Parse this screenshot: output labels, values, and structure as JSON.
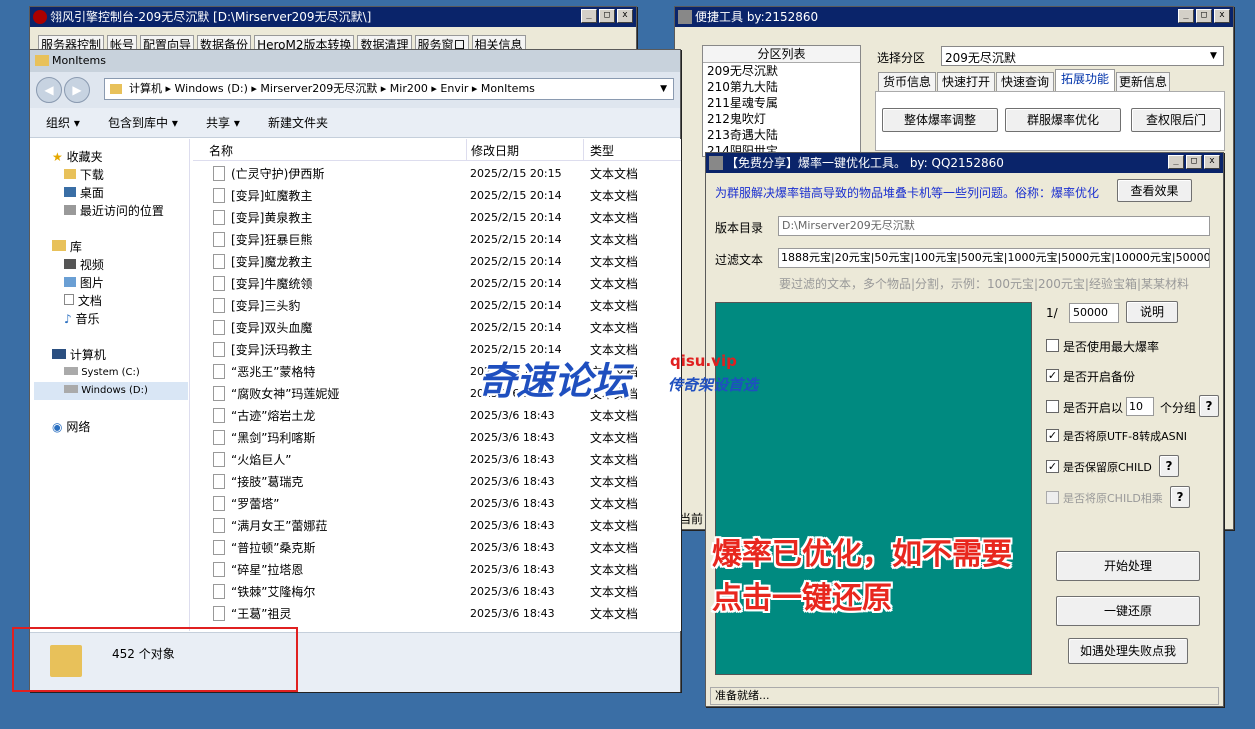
{
  "control": {
    "title": "翎风引擎控制台-209无尽沉默  [D:\\Mirserver209无尽沉默\\]",
    "menus": [
      "服务器控制",
      "帐号",
      "配置向导",
      "数据备份",
      "HeroM2版本转换",
      "数据清理",
      "服务窗口",
      "相关信息"
    ]
  },
  "explorer": {
    "title": "MonItems",
    "address": [
      "计算机",
      "Windows (D:)",
      "Mirserver209无尽沉默",
      "Mir200",
      "Envir",
      "MonItems"
    ],
    "toolbar": [
      "组织",
      "包含到库中",
      "共享",
      "新建文件夹"
    ],
    "nav": {
      "favorites": "收藏夹",
      "favorites_items": [
        "下载",
        "桌面",
        "最近访问的位置"
      ],
      "library": "库",
      "library_items": [
        "视频",
        "图片",
        "文档",
        "音乐"
      ],
      "computer": "计算机",
      "drives": [
        "System (C:)",
        "Windows (D:)"
      ],
      "network": "网络"
    },
    "columns": {
      "name": "名称",
      "date": "修改日期",
      "type": "类型"
    },
    "files": [
      {
        "name": "(亡灵守护)伊西斯",
        "date": "2025/2/15 20:15",
        "type": "文本文档"
      },
      {
        "name": "[变异]虹魔教主",
        "date": "2025/2/15 20:14",
        "type": "文本文档"
      },
      {
        "name": "[变异]黄泉教主",
        "date": "2025/2/15 20:14",
        "type": "文本文档"
      },
      {
        "name": "[变异]狂暴巨熊",
        "date": "2025/2/15 20:14",
        "type": "文本文档"
      },
      {
        "name": "[变异]魔龙教主",
        "date": "2025/2/15 20:14",
        "type": "文本文档"
      },
      {
        "name": "[变异]牛魔统领",
        "date": "2025/2/15 20:14",
        "type": "文本文档"
      },
      {
        "name": "[变异]三头豹",
        "date": "2025/2/15 20:14",
        "type": "文本文档"
      },
      {
        "name": "[变异]双头血魔",
        "date": "2025/2/15 20:14",
        "type": "文本文档"
      },
      {
        "name": "[变异]沃玛教主",
        "date": "2025/2/15 20:14",
        "type": "文本文档"
      },
      {
        "name": "“恶兆王”蒙格特",
        "date": "2025/3/6 18:43",
        "type": "文本文档"
      },
      {
        "name": "“腐败女神”玛莲妮娅",
        "date": "2025/3/6 18:43",
        "type": "文本文档"
      },
      {
        "name": "“古迹”熔岩土龙",
        "date": "2025/3/6 18:43",
        "type": "文本文档"
      },
      {
        "name": "“黑剑”玛利喀斯",
        "date": "2025/3/6 18:43",
        "type": "文本文档"
      },
      {
        "name": "“火焰巨人”",
        "date": "2025/3/6 18:43",
        "type": "文本文档"
      },
      {
        "name": "“接肢”葛瑞克",
        "date": "2025/3/6 18:43",
        "type": "文本文档"
      },
      {
        "name": "“罗蕾塔”",
        "date": "2025/3/6 18:43",
        "type": "文本文档"
      },
      {
        "name": "“满月女王”蕾娜菈",
        "date": "2025/3/6 18:43",
        "type": "文本文档"
      },
      {
        "name": "“普拉顿”桑克斯",
        "date": "2025/3/6 18:43",
        "type": "文本文档"
      },
      {
        "name": "“碎星”拉塔恩",
        "date": "2025/3/6 18:43",
        "type": "文本文档"
      },
      {
        "name": "“铁棘”艾隆梅尔",
        "date": "2025/3/6 18:43",
        "type": "文本文档"
      },
      {
        "name": "“王葛”祖灵",
        "date": "2025/3/6 18:43",
        "type": "文本文档"
      }
    ],
    "status": "452 个对象"
  },
  "quick": {
    "title": "便捷工具   by:2152860",
    "partition_header": "分区列表",
    "partitions": [
      "209无尽沉默",
      "210第九大陆",
      "211星魂专属",
      "212鬼吹灯",
      "213奇遇大陆",
      "214阴阳世宝"
    ],
    "select_label": "选择分区",
    "select_value": "209无尽沉默",
    "tabs": [
      "货币信息",
      "快速打开",
      "快速查询",
      "拓展功能",
      "更新信息"
    ],
    "buttons": [
      "整体爆率调整",
      "群服爆率优化",
      "查权限后门"
    ],
    "status_partial": "当前"
  },
  "opt": {
    "title": "【免费分享】爆率一键优化工具。    by: QQ2152860",
    "desc": "为群服解决爆率错高导致的物品堆叠卡机等一些列问题。俗称：爆率优化",
    "view_effect": "查看效果",
    "dir_label": "版本目录",
    "dir_value": "D:\\Mirserver209无尽沉默",
    "filter_label": "过滤文本",
    "filter_value": "1888元宝|20元宝|50元宝|100元宝|500元宝|1000元宝|5000元宝|10000元宝|50000",
    "hint": "要过滤的文本，多个物品|分割，示例：100元宝|200元宝|经验宝箱|某某材料",
    "ratio_prefix": "1/",
    "ratio_value": "50000",
    "explain": "说明",
    "options": [
      "是否使用最大爆率",
      "是否开启备份",
      "是否开启以",
      "是否将原UTF-8转成ASNI",
      "是否保留原CHILD",
      "是否将原CHILD相乘"
    ],
    "checked": [
      false,
      true,
      false,
      true,
      true,
      false
    ],
    "group_value": "10",
    "group_suffix": "个分组",
    "q": "?",
    "overlay_text": [
      "爆率已优化，如不需要",
      "点击一键还原"
    ],
    "start": "开始处理",
    "restore": "一键还原",
    "fail": "如遇处理失败点我",
    "status": "准备就绪..."
  },
  "watermark": {
    "site": "qisu.vip",
    "name": "奇速论坛",
    "sub": "传奇架设首选"
  }
}
